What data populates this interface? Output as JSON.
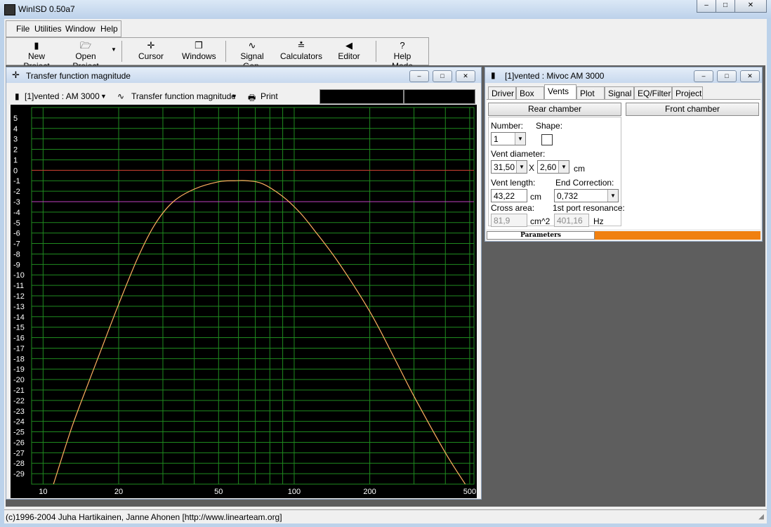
{
  "app": {
    "title": "WinISD 0.50a7"
  },
  "window_controls": {
    "minimize": "–",
    "maximize": "□",
    "close": "✕"
  },
  "menu": {
    "file": "File",
    "utilities": "Utilities",
    "window": "Window",
    "help": "Help"
  },
  "toolbar": {
    "new_project": "New Project",
    "open_project": "Open Project",
    "cursor": "Cursor",
    "windows": "Windows",
    "signal_gen": "Signal Gen.",
    "calculators": "Calculators",
    "editor": "Editor",
    "help_mode": "Help Mode"
  },
  "graph_window": {
    "title": "Transfer function magnitude",
    "project_select": "[1]vented : AM 3000",
    "graph_select": "Transfer function magnitude",
    "print_label": "Print"
  },
  "chart_data": {
    "type": "line",
    "xscale": "log",
    "xlim": [
      9,
      520
    ],
    "ylim": [
      -30,
      6
    ],
    "x_ticks": [
      10,
      20,
      50,
      100,
      200,
      500
    ],
    "y_ticks": [
      5,
      4,
      3,
      2,
      1,
      0,
      -1,
      -2,
      -3,
      -4,
      -5,
      -6,
      -7,
      -8,
      -9,
      -10,
      -11,
      -12,
      -13,
      -14,
      -15,
      -16,
      -17,
      -18,
      -19,
      -20,
      -21,
      -22,
      -23,
      -24,
      -25,
      -26,
      -27,
      -28,
      -29
    ],
    "grid": true,
    "reference_lines": [
      {
        "y": 0,
        "color": "#d03030"
      },
      {
        "y": -3,
        "color": "#c040c0"
      }
    ],
    "series": [
      {
        "color": "#ffb060",
        "x": [
          11,
          13,
          15,
          17,
          20,
          24,
          28,
          33,
          40,
          50,
          58,
          65,
          75,
          90,
          105,
          120,
          150,
          200,
          250,
          300,
          400,
          480
        ],
        "y": [
          -30,
          -24.6,
          -20.6,
          -17.2,
          -12.8,
          -8.2,
          -5.1,
          -3.0,
          -1.8,
          -1.1,
          -1.0,
          -1.0,
          -1.3,
          -2.5,
          -4.0,
          -5.7,
          -8.8,
          -13.5,
          -17.9,
          -21.6,
          -27.0,
          -30
        ]
      }
    ]
  },
  "param_window": {
    "title": "[1]vented : Mivoc AM 3000",
    "tabs": [
      "Driver",
      "Box",
      "Vents",
      "Plot",
      "Signal",
      "EQ/Filter",
      "Project"
    ],
    "rear_chamber": "Rear chamber",
    "front_chamber": "Front chamber",
    "number_label": "Number:",
    "number_value": "1",
    "shape_label": "Shape:",
    "vent_diameter_label": "Vent diameter:",
    "vent_dim1": "31,50",
    "times": "X",
    "vent_dim2": "2,60",
    "unit_cm": "cm",
    "vent_length_label": "Vent length:",
    "vent_length_value": "43,22",
    "end_correction_label": "End Correction:",
    "end_correction_value": "0,732",
    "cross_area_label": "Cross area:",
    "cross_area_value": "81,9",
    "cross_area_unit": "cm^2",
    "resonance_label": "1st port resonance:",
    "resonance_value": "401,16",
    "resonance_unit": "Hz",
    "parameters_label": "Parameters"
  },
  "status": {
    "text": "(c)1996-2004 Juha Hartikainen, Janne Ahonen [http://www.linearteam.org]"
  }
}
